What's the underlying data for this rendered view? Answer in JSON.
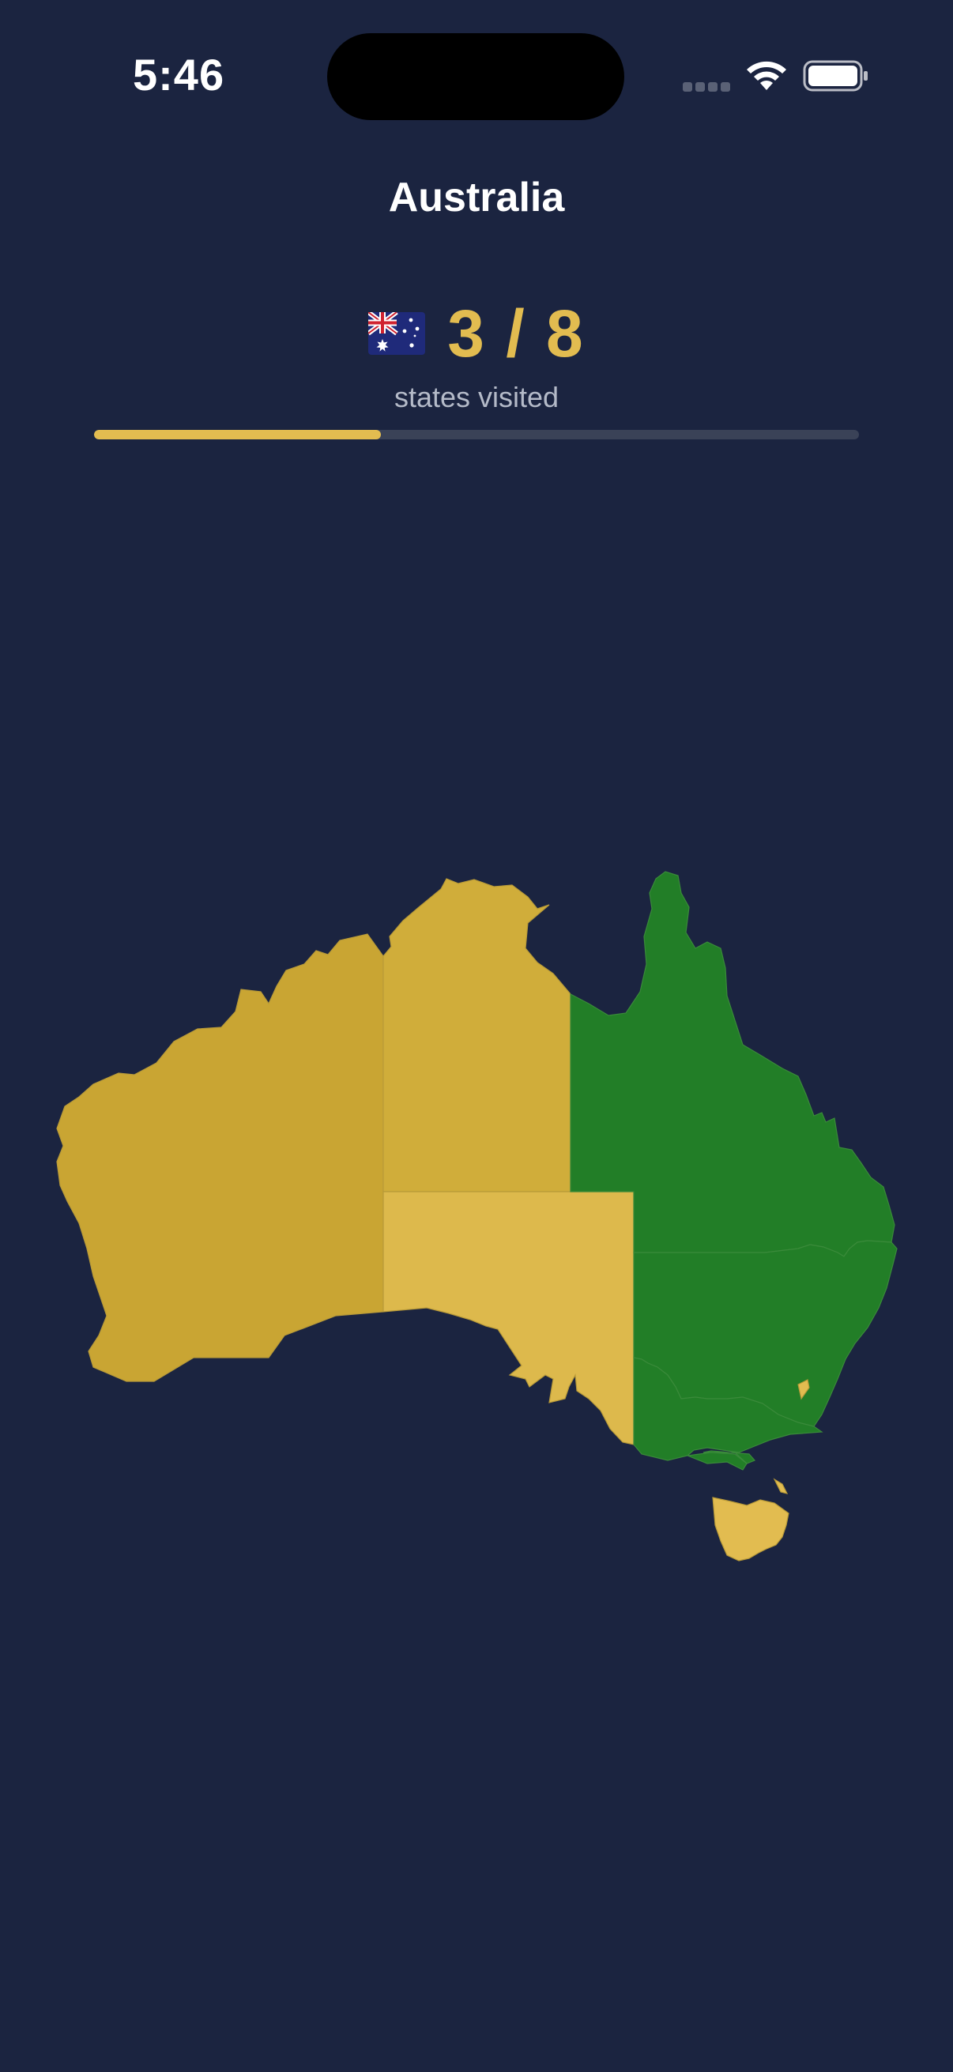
{
  "status_bar": {
    "time": "5:46",
    "icons": [
      "cell-signal-icon",
      "wifi-icon",
      "battery-icon"
    ]
  },
  "header": {
    "title": "Australia",
    "flag_icon": "australia-flag-icon",
    "visited_count": "3 / 8",
    "visited_label": "states visited"
  },
  "progress": {
    "visited": 3,
    "total": 8,
    "fraction": 0.375
  },
  "map": {
    "regions": [
      {
        "name": "Western Australia",
        "visited": false
      },
      {
        "name": "Northern Territory",
        "visited": false
      },
      {
        "name": "South Australia",
        "visited": false
      },
      {
        "name": "Queensland",
        "visited": true
      },
      {
        "name": "New South Wales",
        "visited": true
      },
      {
        "name": "Victoria",
        "visited": true
      },
      {
        "name": "Australian Capital Territory",
        "visited": false
      },
      {
        "name": "Tasmania",
        "visited": false
      }
    ]
  },
  "colors": {
    "background": "#1b2440",
    "accent": "#e2bc50",
    "visited": "#227e27",
    "unvisited_wa": "#c9a533",
    "unvisited_nt": "#d0ad3a",
    "unvisited_sa": "#ddb94c",
    "unvisited_tas": "#e2bc50",
    "track": "#3a4257"
  }
}
